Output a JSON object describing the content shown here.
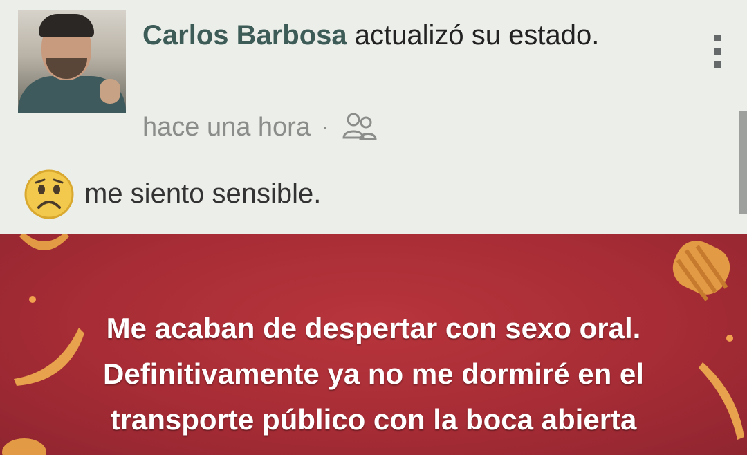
{
  "post": {
    "author": "Carlos Barbosa",
    "action": "actualizó su estado.",
    "time": "hace una hora",
    "separator": "·",
    "audience_icon": "friends-icon",
    "feeling": "me siento sensible.",
    "feeling_icon": "sad-face-icon",
    "message_lines": [
      "Me acaban de despertar con sexo oral.",
      "Definitivamente ya no me dormiré en el",
      "transporte público con la boca abierta"
    ]
  },
  "colors": {
    "author": "#3d5c58",
    "background_card": "#b8353c",
    "message_text": "#ffffff"
  }
}
